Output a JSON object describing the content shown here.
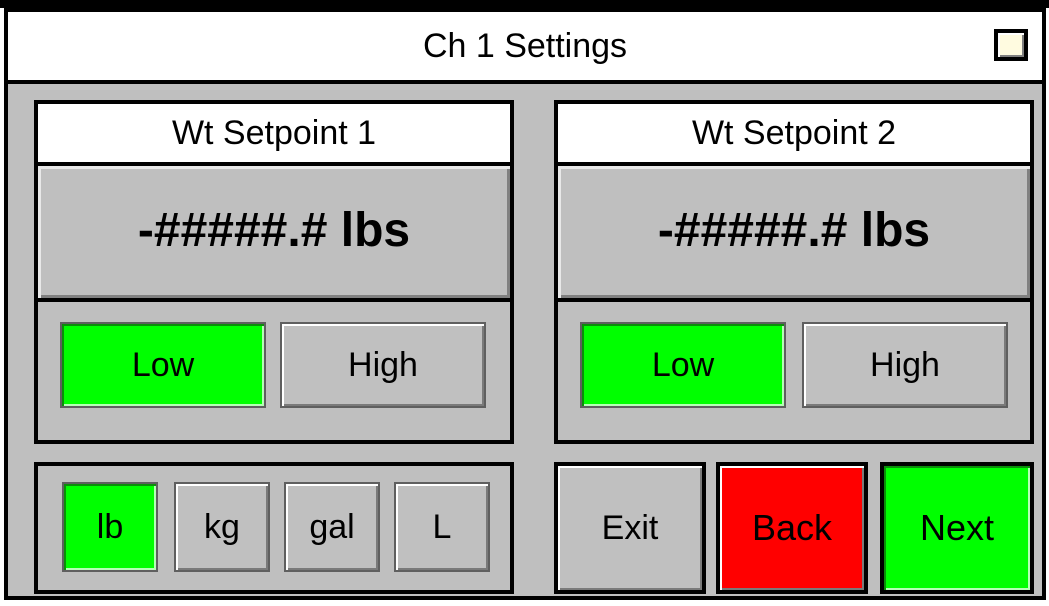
{
  "window": {
    "title": "Ch 1 Settings"
  },
  "setpoint1": {
    "title": "Wt Setpoint 1",
    "value": "-#####.# lbs",
    "low_label": "Low",
    "high_label": "High",
    "selected": "Low"
  },
  "setpoint2": {
    "title": "Wt Setpoint 2",
    "value": "-#####.# lbs",
    "low_label": "Low",
    "high_label": "High",
    "selected": "Low"
  },
  "units": {
    "items": [
      {
        "label": "lb",
        "selected": true
      },
      {
        "label": "kg",
        "selected": false
      },
      {
        "label": "gal",
        "selected": false
      },
      {
        "label": "L",
        "selected": false
      }
    ]
  },
  "nav": {
    "exit_label": "Exit",
    "back_label": "Back",
    "next_label": "Next"
  },
  "colors": {
    "background": "#bfbfbf",
    "selected": "#00ff00",
    "back": "#ff0000",
    "next": "#00ff00",
    "header": "#ffffff",
    "border": "#000000"
  },
  "icons": {
    "corner": "indicator-box-icon"
  }
}
